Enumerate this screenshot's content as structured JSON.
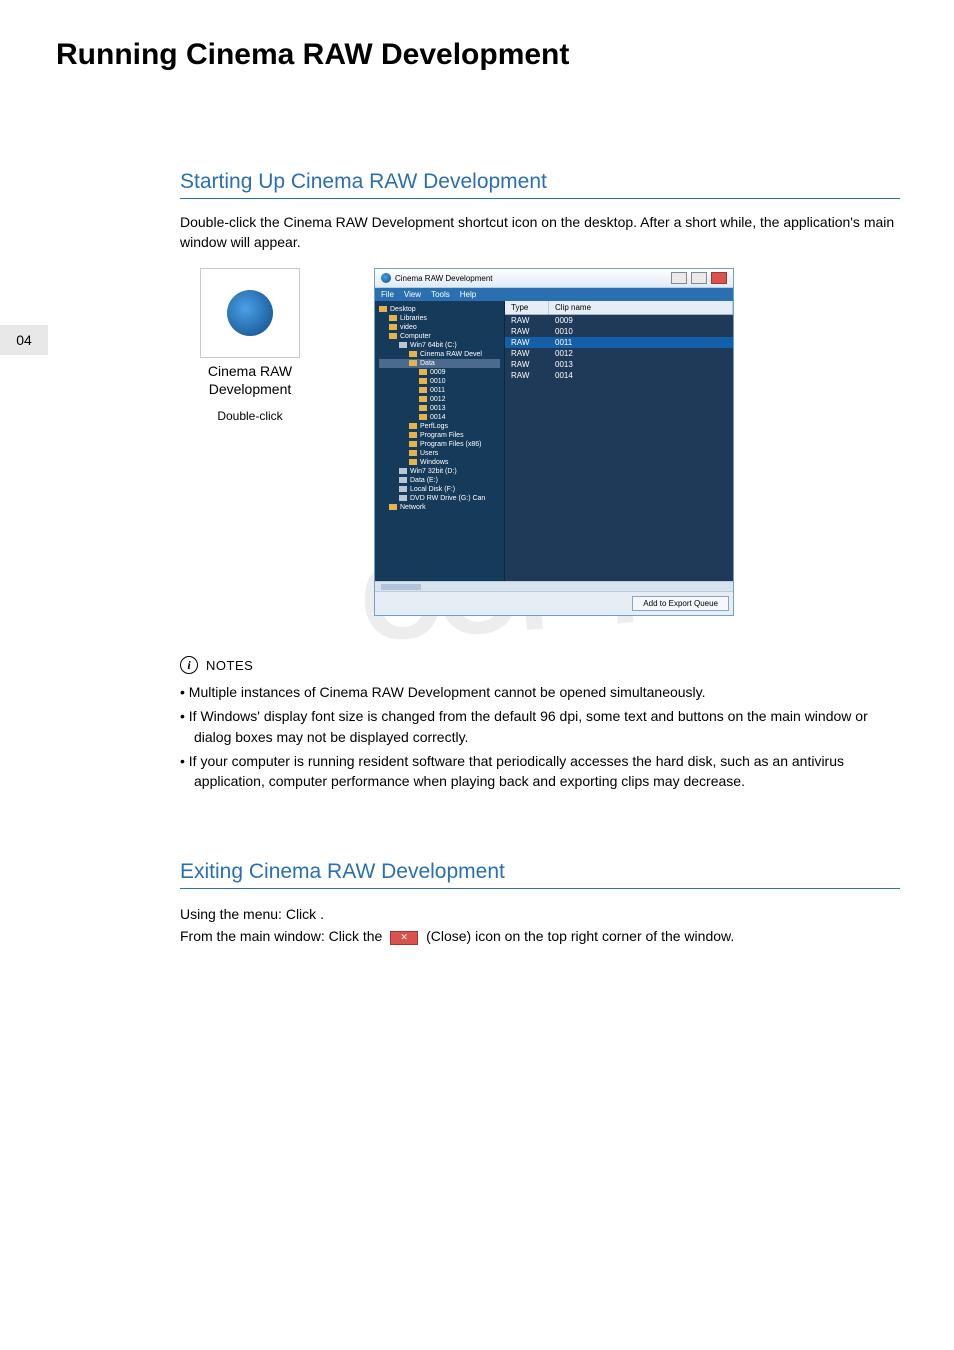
{
  "page": {
    "title": "Running Cinema RAW Development",
    "number": "04"
  },
  "section_start": {
    "heading": "Starting Up Cinema RAW Development",
    "body": "Double-click the Cinema RAW Development shortcut icon on the desktop. After a short while, the application's main window will appear.",
    "shortcut_label": "Cinema RAW Development",
    "shortcut_caption": "Double-click"
  },
  "app_window": {
    "title": "Cinema RAW Development",
    "menus": [
      "File",
      "View",
      "Tools",
      "Help"
    ],
    "tree": [
      {
        "label": "Desktop",
        "indent": 0,
        "icon": "desktop"
      },
      {
        "label": "Libraries",
        "indent": 1,
        "icon": "folder"
      },
      {
        "label": "video",
        "indent": 1,
        "icon": "folder"
      },
      {
        "label": "Computer",
        "indent": 1,
        "icon": "computer"
      },
      {
        "label": "Win7 64bit (C:)",
        "indent": 2,
        "icon": "disk"
      },
      {
        "label": "Cinema RAW Devel",
        "indent": 3,
        "icon": "folder"
      },
      {
        "label": "Data",
        "indent": 3,
        "icon": "folder",
        "selected": true
      },
      {
        "label": "0009",
        "indent": 4,
        "icon": "folder"
      },
      {
        "label": "0010",
        "indent": 4,
        "icon": "folder"
      },
      {
        "label": "0011",
        "indent": 4,
        "icon": "folder"
      },
      {
        "label": "0012",
        "indent": 4,
        "icon": "folder"
      },
      {
        "label": "0013",
        "indent": 4,
        "icon": "folder"
      },
      {
        "label": "0014",
        "indent": 4,
        "icon": "folder"
      },
      {
        "label": "PerfLogs",
        "indent": 3,
        "icon": "folder"
      },
      {
        "label": "Program Files",
        "indent": 3,
        "icon": "folder"
      },
      {
        "label": "Program Files (x86)",
        "indent": 3,
        "icon": "folder"
      },
      {
        "label": "Users",
        "indent": 3,
        "icon": "folder"
      },
      {
        "label": "Windows",
        "indent": 3,
        "icon": "folder"
      },
      {
        "label": "Win7 32bit (D:)",
        "indent": 2,
        "icon": "disk"
      },
      {
        "label": "Data (E:)",
        "indent": 2,
        "icon": "disk"
      },
      {
        "label": "Local Disk (F:)",
        "indent": 2,
        "icon": "disk"
      },
      {
        "label": "DVD RW Drive (G:) Can",
        "indent": 2,
        "icon": "disc"
      },
      {
        "label": "Network",
        "indent": 1,
        "icon": "network"
      }
    ],
    "list_headers": {
      "type": "Type",
      "clip": "Clip name"
    },
    "list_rows": [
      {
        "type": "RAW",
        "name": "0009"
      },
      {
        "type": "RAW",
        "name": "0010"
      },
      {
        "type": "RAW",
        "name": "0011",
        "selected": true
      },
      {
        "type": "RAW",
        "name": "0012"
      },
      {
        "type": "RAW",
        "name": "0013"
      },
      {
        "type": "RAW",
        "name": "0014"
      }
    ],
    "footer_button": "Add to Export Queue"
  },
  "notes": {
    "label": "NOTES",
    "items": [
      "Multiple instances of Cinema RAW Development cannot be opened simultaneously.",
      "If Windows' display font size is changed from the default 96 dpi, some text and buttons on the main window or dialog boxes may not be displayed correctly.",
      "If your computer is running resident software that periodically accesses the hard disk, such as an antivirus application, computer performance when playing back and exporting clips may decrease."
    ]
  },
  "watermark": "COPY",
  "section_exit": {
    "heading": "Exiting Cinema RAW Development",
    "line1_pre": "Using the menu: Click ",
    "line1_post": ".",
    "line2_pre": "From the main window: Click the ",
    "line2_post": " (Close) icon on the top right corner of the window."
  }
}
